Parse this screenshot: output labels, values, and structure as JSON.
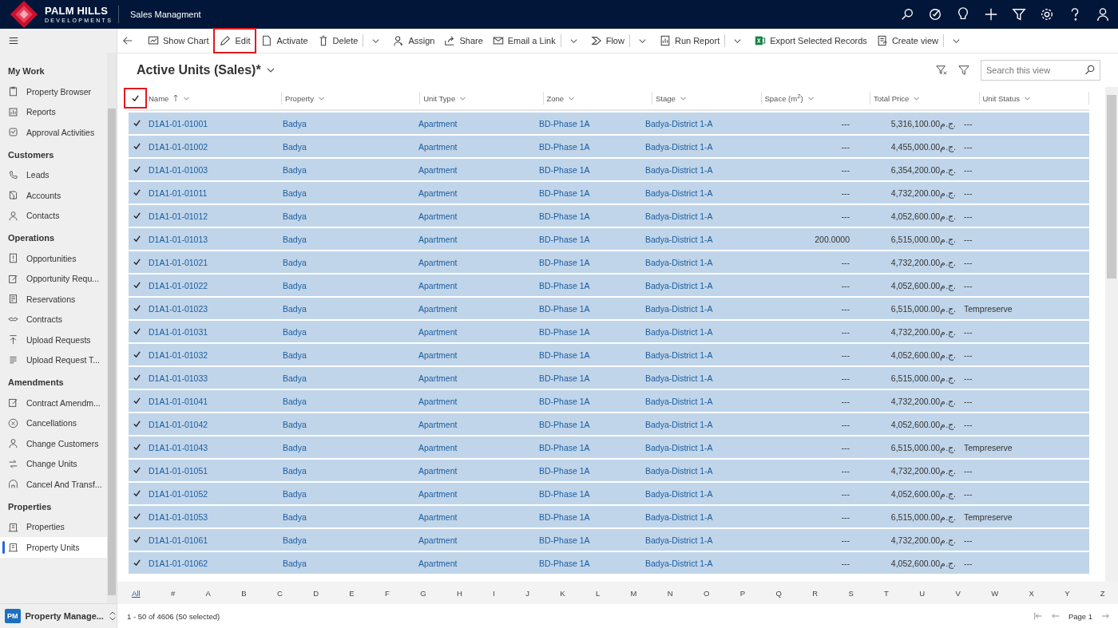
{
  "app": {
    "brand_line1": "PALM HILLS",
    "brand_line2": "DEVELOPMENTS",
    "title": "Sales Managment"
  },
  "commands": [
    {
      "label": "Show Chart",
      "highlighted": false,
      "dropdown": false
    },
    {
      "label": "Edit",
      "highlighted": true,
      "dropdown": false
    },
    {
      "label": "Activate",
      "highlighted": false,
      "dropdown": false
    },
    {
      "label": "Delete",
      "highlighted": false,
      "dropdown": true
    },
    {
      "label": "Assign",
      "highlighted": false,
      "dropdown": false
    },
    {
      "label": "Share",
      "highlighted": false,
      "dropdown": false
    },
    {
      "label": "Email a Link",
      "highlighted": false,
      "dropdown": true
    },
    {
      "label": "Flow",
      "highlighted": false,
      "dropdown": true
    },
    {
      "label": "Run Report",
      "highlighted": false,
      "dropdown": true
    },
    {
      "label": "Export Selected Records",
      "highlighted": false,
      "dropdown": false
    },
    {
      "label": "Create view",
      "highlighted": false,
      "dropdown": true
    }
  ],
  "sidebar": {
    "groups": [
      {
        "title": "My Work",
        "items": [
          {
            "label": "Property Browser",
            "selected": false
          },
          {
            "label": "Reports",
            "selected": false
          },
          {
            "label": "Approval Activities",
            "selected": false
          }
        ]
      },
      {
        "title": "Customers",
        "items": [
          {
            "label": "Leads",
            "selected": false
          },
          {
            "label": "Accounts",
            "selected": false
          },
          {
            "label": "Contacts",
            "selected": false
          }
        ]
      },
      {
        "title": "Operations",
        "items": [
          {
            "label": "Opportunities",
            "selected": false
          },
          {
            "label": "Opportunity Requ...",
            "selected": false
          },
          {
            "label": "Reservations",
            "selected": false
          },
          {
            "label": "Contracts",
            "selected": false
          },
          {
            "label": "Upload Requests",
            "selected": false
          },
          {
            "label": "Upload Request T...",
            "selected": false
          }
        ]
      },
      {
        "title": "Amendments",
        "items": [
          {
            "label": "Contract Amendm...",
            "selected": false
          },
          {
            "label": "Cancellations",
            "selected": false
          },
          {
            "label": "Change Customers",
            "selected": false
          },
          {
            "label": "Change Units",
            "selected": false
          },
          {
            "label": "Cancel And Transf...",
            "selected": false
          }
        ]
      },
      {
        "title": "Properties",
        "items": [
          {
            "label": "Properties",
            "selected": false
          },
          {
            "label": "Property Units",
            "selected": true
          }
        ]
      }
    ],
    "area": {
      "badge": "PM",
      "label": "Property Manage..."
    }
  },
  "view": {
    "title": "Active Units (Sales)*",
    "search": {
      "placeholder": "Search this view"
    }
  },
  "table": {
    "select_all": {
      "checked": true,
      "highlighted": true
    },
    "columns": [
      {
        "label": "Name",
        "sorted": true
      },
      {
        "label": "Property",
        "sorted": false
      },
      {
        "label": "Unit Type",
        "sorted": false
      },
      {
        "label": "Zone",
        "sorted": false
      },
      {
        "label": "Stage",
        "sorted": false
      },
      {
        "label": "Space (m$^{2}$)",
        "sorted": false
      },
      {
        "label": "Total Price",
        "sorted": false
      },
      {
        "label": "Unit Status",
        "sorted": false
      }
    ],
    "rows": [
      {
        "selected": true,
        "cells": [
          "D1A1-01-01001",
          "Badya",
          "Apartment",
          "BD-Phase 1A",
          "Badya-District 1-A",
          "---",
          "5,316,100.00ج.م.",
          "---"
        ]
      },
      {
        "selected": true,
        "cells": [
          "D1A1-01-01002",
          "Badya",
          "Apartment",
          "BD-Phase 1A",
          "Badya-District 1-A",
          "---",
          "4,455,000.00ج.م.",
          "---"
        ]
      },
      {
        "selected": true,
        "cells": [
          "D1A1-01-01003",
          "Badya",
          "Apartment",
          "BD-Phase 1A",
          "Badya-District 1-A",
          "---",
          "6,354,200.00ج.م.",
          "---"
        ]
      },
      {
        "selected": true,
        "cells": [
          "D1A1-01-01011",
          "Badya",
          "Apartment",
          "BD-Phase 1A",
          "Badya-District 1-A",
          "---",
          "4,732,200.00ج.م.",
          "---"
        ]
      },
      {
        "selected": true,
        "cells": [
          "D1A1-01-01012",
          "Badya",
          "Apartment",
          "BD-Phase 1A",
          "Badya-District 1-A",
          "---",
          "4,052,600.00ج.م.",
          "---"
        ]
      },
      {
        "selected": true,
        "cells": [
          "D1A1-01-01013",
          "Badya",
          "Apartment",
          "BD-Phase 1A",
          "Badya-District 1-A",
          "200.0000",
          "6,515,000.00ج.م.",
          "---"
        ]
      },
      {
        "selected": true,
        "cells": [
          "D1A1-01-01021",
          "Badya",
          "Apartment",
          "BD-Phase 1A",
          "Badya-District 1-A",
          "---",
          "4,732,200.00ج.م.",
          "---"
        ]
      },
      {
        "selected": true,
        "cells": [
          "D1A1-01-01022",
          "Badya",
          "Apartment",
          "BD-Phase 1A",
          "Badya-District 1-A",
          "---",
          "4,052,600.00ج.م.",
          "---"
        ]
      },
      {
        "selected": true,
        "cells": [
          "D1A1-01-01023",
          "Badya",
          "Apartment",
          "BD-Phase 1A",
          "Badya-District 1-A",
          "---",
          "6,515,000.00ج.م.",
          "Tempreserve"
        ]
      },
      {
        "selected": true,
        "cells": [
          "D1A1-01-01031",
          "Badya",
          "Apartment",
          "BD-Phase 1A",
          "Badya-District 1-A",
          "---",
          "4,732,200.00ج.م.",
          "---"
        ]
      },
      {
        "selected": true,
        "cells": [
          "D1A1-01-01032",
          "Badya",
          "Apartment",
          "BD-Phase 1A",
          "Badya-District 1-A",
          "---",
          "4,052,600.00ج.م.",
          "---"
        ]
      },
      {
        "selected": true,
        "cells": [
          "D1A1-01-01033",
          "Badya",
          "Apartment",
          "BD-Phase 1A",
          "Badya-District 1-A",
          "---",
          "6,515,000.00ج.م.",
          "---"
        ]
      },
      {
        "selected": true,
        "cells": [
          "D1A1-01-01041",
          "Badya",
          "Apartment",
          "BD-Phase 1A",
          "Badya-District 1-A",
          "---",
          "4,732,200.00ج.م.",
          "---"
        ]
      },
      {
        "selected": true,
        "cells": [
          "D1A1-01-01042",
          "Badya",
          "Apartment",
          "BD-Phase 1A",
          "Badya-District 1-A",
          "---",
          "4,052,600.00ج.م.",
          "---"
        ]
      },
      {
        "selected": true,
        "cells": [
          "D1A1-01-01043",
          "Badya",
          "Apartment",
          "BD-Phase 1A",
          "Badya-District 1-A",
          "---",
          "6,515,000.00ج.م.",
          "Tempreserve"
        ]
      },
      {
        "selected": true,
        "cells": [
          "D1A1-01-01051",
          "Badya",
          "Apartment",
          "BD-Phase 1A",
          "Badya-District 1-A",
          "---",
          "4,732,200.00ج.م.",
          "---"
        ]
      },
      {
        "selected": true,
        "cells": [
          "D1A1-01-01052",
          "Badya",
          "Apartment",
          "BD-Phase 1A",
          "Badya-District 1-A",
          "---",
          "4,052,600.00ج.م.",
          "---"
        ]
      },
      {
        "selected": true,
        "cells": [
          "D1A1-01-01053",
          "Badya",
          "Apartment",
          "BD-Phase 1A",
          "Badya-District 1-A",
          "---",
          "6,515,000.00ج.م.",
          "Tempreserve"
        ]
      },
      {
        "selected": true,
        "cells": [
          "D1A1-01-01061",
          "Badya",
          "Apartment",
          "BD-Phase 1A",
          "Badya-District 1-A",
          "---",
          "4,732,200.00ج.م.",
          "---"
        ]
      },
      {
        "selected": true,
        "cells": [
          "D1A1-01-01062",
          "Badya",
          "Apartment",
          "BD-Phase 1A",
          "Badya-District 1-A",
          "---",
          "4,052,600.00ج.م.",
          "---"
        ]
      }
    ]
  },
  "alphabet": [
    {
      "label": "All",
      "selected": true
    },
    {
      "label": "#",
      "selected": false
    },
    {
      "label": "A",
      "selected": false
    },
    {
      "label": "B",
      "selected": false
    },
    {
      "label": "C",
      "selected": false
    },
    {
      "label": "D",
      "selected": false
    },
    {
      "label": "E",
      "selected": false
    },
    {
      "label": "F",
      "selected": false
    },
    {
      "label": "G",
      "selected": false
    },
    {
      "label": "H",
      "selected": false
    },
    {
      "label": "I",
      "selected": false
    },
    {
      "label": "J",
      "selected": false
    },
    {
      "label": "K",
      "selected": false
    },
    {
      "label": "L",
      "selected": false
    },
    {
      "label": "M",
      "selected": false
    },
    {
      "label": "N",
      "selected": false
    },
    {
      "label": "O",
      "selected": false
    },
    {
      "label": "P",
      "selected": false
    },
    {
      "label": "Q",
      "selected": false
    },
    {
      "label": "R",
      "selected": false
    },
    {
      "label": "S",
      "selected": false
    },
    {
      "label": "T",
      "selected": false
    },
    {
      "label": "U",
      "selected": false
    },
    {
      "label": "V",
      "selected": false
    },
    {
      "label": "W",
      "selected": false
    },
    {
      "label": "X",
      "selected": false
    },
    {
      "label": "Y",
      "selected": false
    },
    {
      "label": "Z",
      "selected": false
    }
  ],
  "footer": {
    "count": "1 - 50 of 4606 (50 selected)",
    "page": "Page 1"
  }
}
